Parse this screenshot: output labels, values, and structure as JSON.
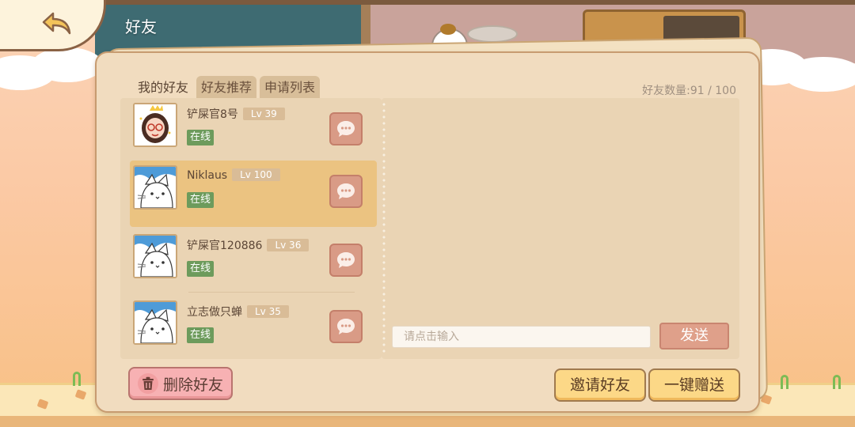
{
  "header": {
    "title": "好友",
    "back_icon": "back-arrow-icon"
  },
  "tabs": [
    {
      "label": "我的好友",
      "active": true
    },
    {
      "label": "好友推荐",
      "active": false
    },
    {
      "label": "申请列表",
      "active": false
    }
  ],
  "friend_count": "好友数量:91 / 100",
  "friends": [
    {
      "name": "铲屎官8号",
      "level": "Lv 39",
      "status": "在线",
      "avatar": "girl-avatar",
      "selected": false
    },
    {
      "name": "Niklaus",
      "level": "Lv 100",
      "status": "在线",
      "avatar": "cat-avatar",
      "selected": true
    },
    {
      "name": "铲屎官120886",
      "level": "Lv 36",
      "status": "在线",
      "avatar": "cat-avatar",
      "selected": false
    },
    {
      "name": "立志做只蝉",
      "level": "Lv 35",
      "status": "在线",
      "avatar": "cat-avatar",
      "selected": false
    }
  ],
  "chat": {
    "placeholder": "请点击输入",
    "send_label": "发送"
  },
  "buttons": {
    "delete_label": "删除好友",
    "invite_label": "邀请好友",
    "gift_label": "一键赠送"
  },
  "colors": {
    "panel": "#f1dcbf",
    "selected_row": "#ebc381",
    "online_badge": "#6d9b5c",
    "chat_button": "#d99b86",
    "delete_button": "#f7b1b3",
    "action_button": "#fcd887"
  }
}
